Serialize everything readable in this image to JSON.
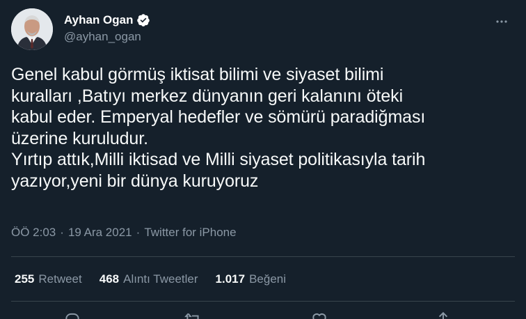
{
  "user": {
    "display_name": "Ayhan Ogan",
    "handle": "@ayhan_ogan",
    "verified_icon": "verified-badge-icon",
    "avatar": "profile-photo"
  },
  "tweet": {
    "text": "Genel kabul görmüş iktisat bilimi ve siyaset bilimi\nkuralları ,Batıyı merkez dünyanın geri kalanını öteki\nkabul eder. Emperyal hedefler ve sömürü paradiğması\nüzerine kuruludur.\nYırtıp attık,Milli iktisad ve Milli siyaset politikasıyla tarih\nyazıyor,yeni bir dünya kuruyoruz",
    "time": "ÖÖ 2:03",
    "separator1": "·",
    "date": "19 Ara 2021",
    "separator2": "·",
    "source": "Twitter for iPhone"
  },
  "stats": {
    "retweets_count": "255",
    "retweets_label": "Retweet",
    "quotes_count": "468",
    "quotes_label": "Alıntı Tweetler",
    "likes_count": "1.017",
    "likes_label": "Beğeni"
  },
  "icons": {
    "more": "more-icon",
    "reply": "reply-icon",
    "retweet": "retweet-icon",
    "like": "heart-icon",
    "share": "share-icon"
  },
  "colors": {
    "background": "#15202b",
    "text": "#f7f9f9",
    "secondary": "#8b98a5",
    "divider": "#38444d",
    "verified": "#ffffff"
  }
}
